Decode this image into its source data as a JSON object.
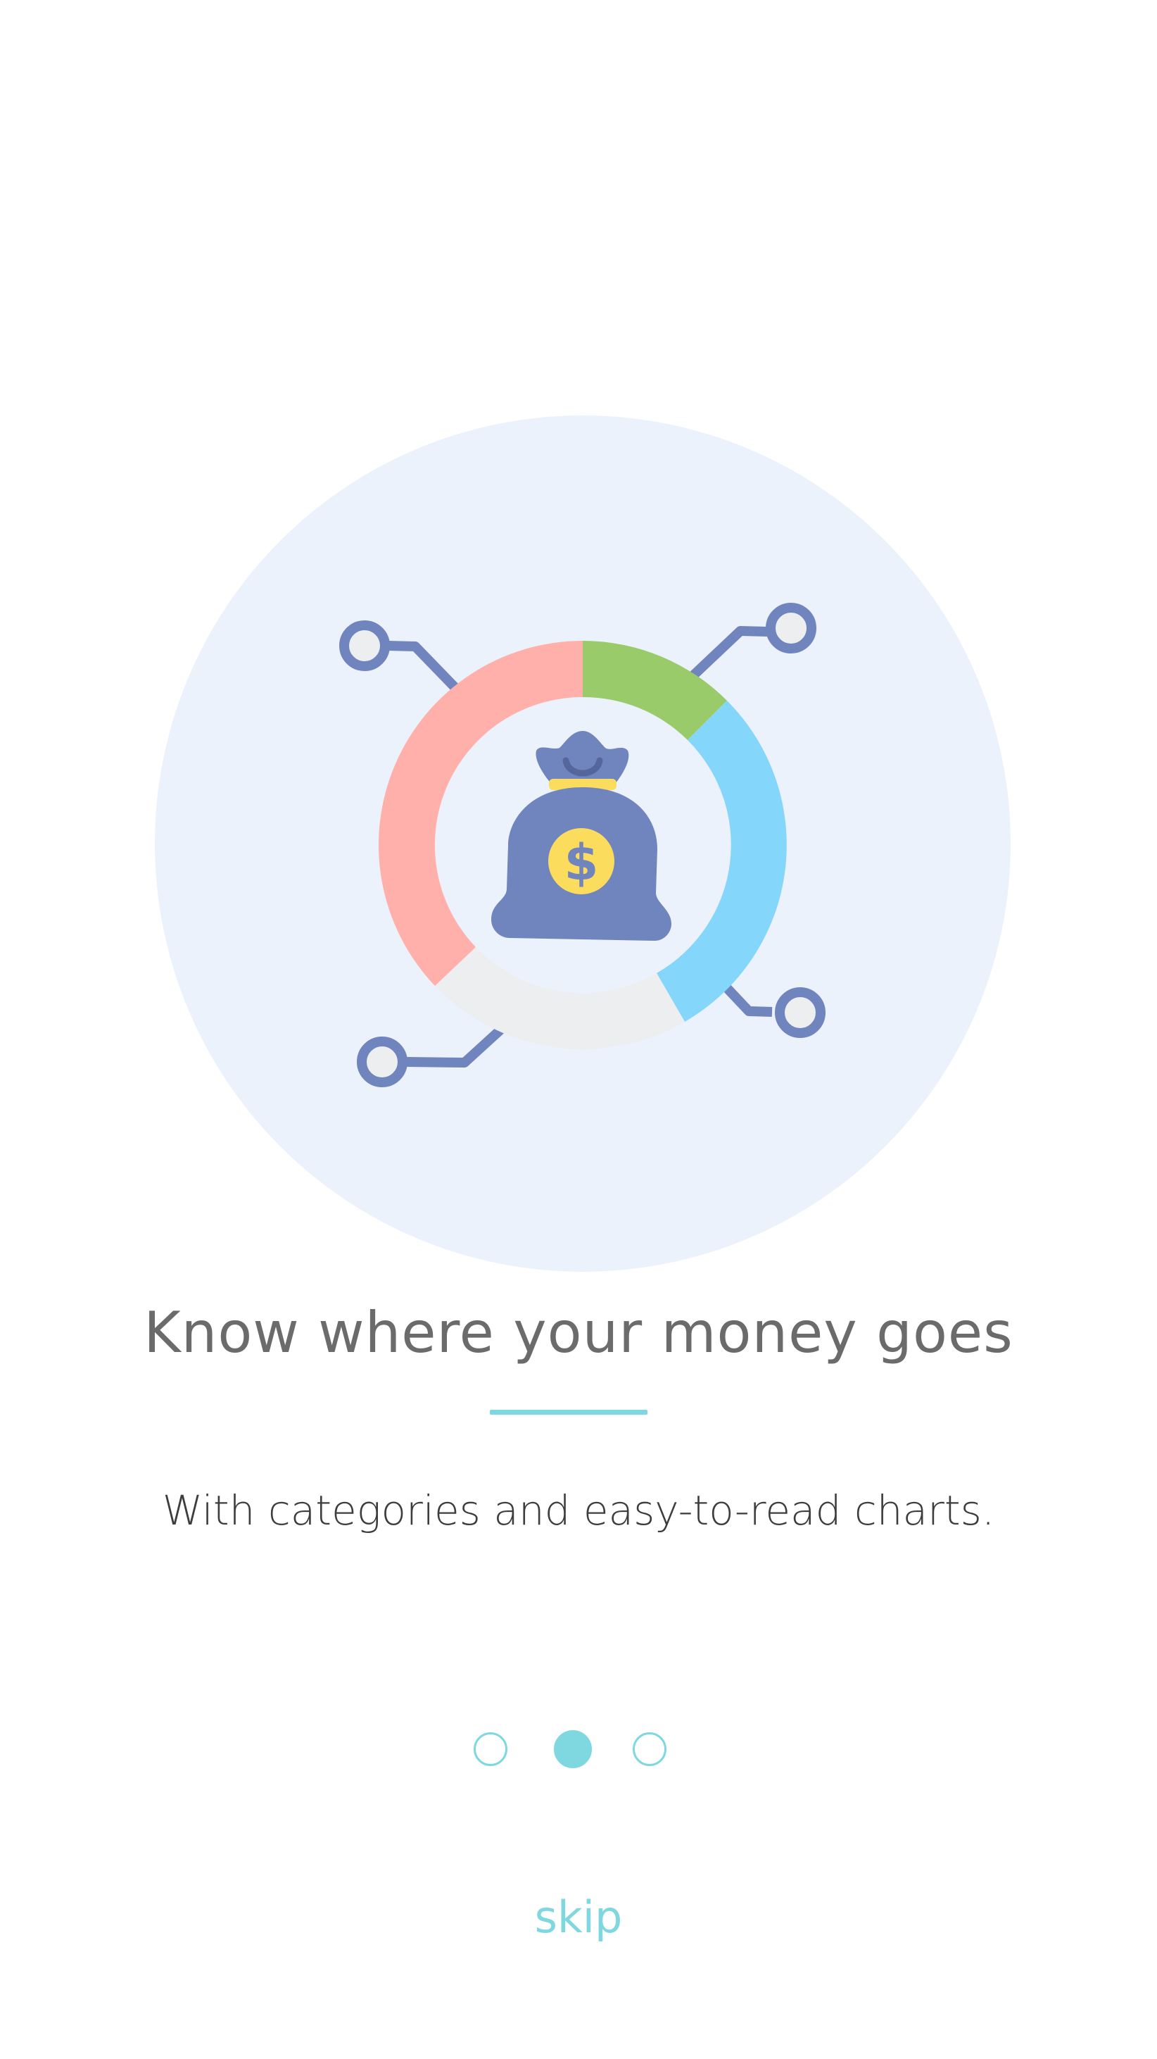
{
  "onboarding": {
    "title": "Know where your money goes",
    "subtitle": "With categories and easy-to-read charts.",
    "skip_label": "skip",
    "pagination": {
      "total_pages": 3,
      "current_page": 2
    }
  },
  "illustration": {
    "icon": "money-bag-donut-chart",
    "segments": [
      {
        "name": "green-segment",
        "color": "#99cb6a"
      },
      {
        "name": "blue-segment",
        "color": "#84d6fb"
      },
      {
        "name": "grey-segment",
        "color": "#eceef0"
      },
      {
        "name": "pink-segment",
        "color": "#ffb0ab"
      }
    ],
    "bag_color": "#7085bd",
    "coin_color": "#fcdc5c",
    "circle_background": "#ebf2fb"
  },
  "colors": {
    "accent": "#7fd8e0",
    "title_text": "#6b6b6b",
    "body_text": "#3d3d3d"
  }
}
